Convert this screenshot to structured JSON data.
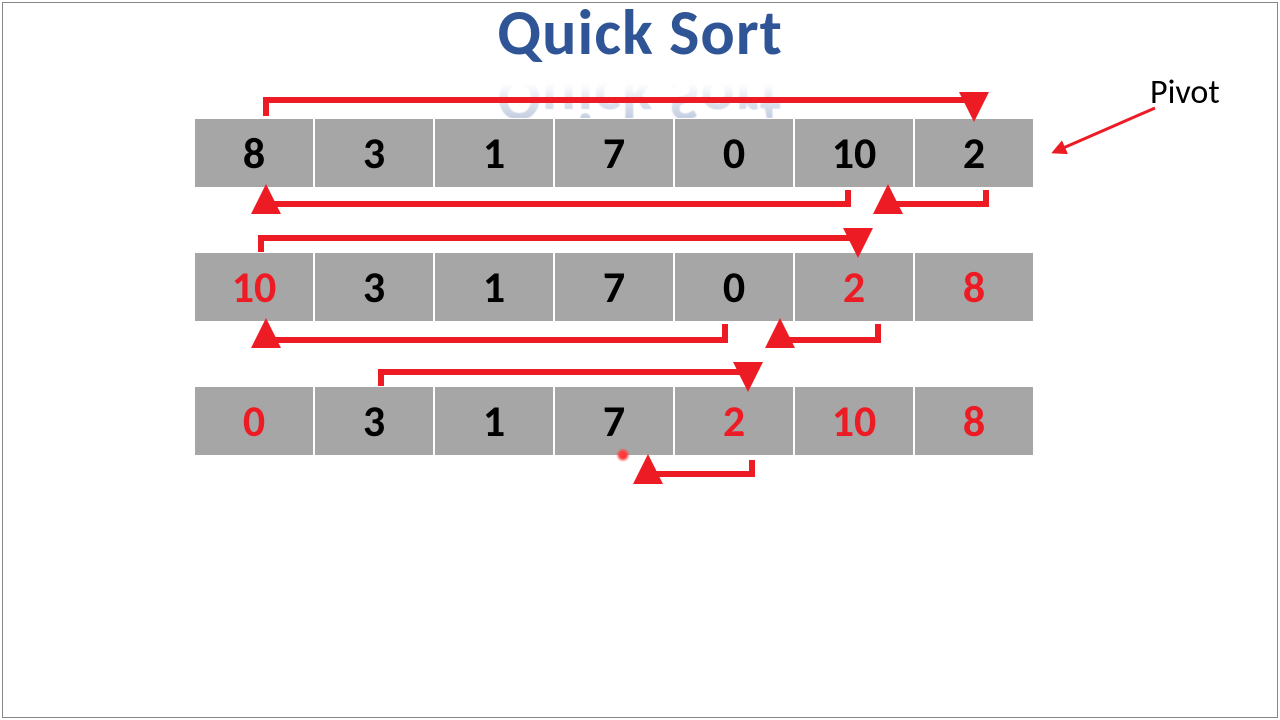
{
  "title": "Quick Sort",
  "pivot_label": "Pivot",
  "rows": [
    {
      "cells": [
        {
          "v": "8",
          "hl": false
        },
        {
          "v": "3",
          "hl": false
        },
        {
          "v": "1",
          "hl": false
        },
        {
          "v": "7",
          "hl": false
        },
        {
          "v": "0",
          "hl": false
        },
        {
          "v": "10",
          "hl": false
        },
        {
          "v": "2",
          "hl": false
        }
      ]
    },
    {
      "cells": [
        {
          "v": "10",
          "hl": true
        },
        {
          "v": "3",
          "hl": false
        },
        {
          "v": "1",
          "hl": false
        },
        {
          "v": "7",
          "hl": false
        },
        {
          "v": "0",
          "hl": false
        },
        {
          "v": "2",
          "hl": true
        },
        {
          "v": "8",
          "hl": true
        }
      ]
    },
    {
      "cells": [
        {
          "v": "0",
          "hl": true
        },
        {
          "v": "3",
          "hl": false
        },
        {
          "v": "1",
          "hl": false
        },
        {
          "v": "7",
          "hl": false
        },
        {
          "v": "2",
          "hl": true
        },
        {
          "v": "10",
          "hl": true
        },
        {
          "v": "8",
          "hl": true
        }
      ]
    }
  ],
  "colors": {
    "accent": "#ed1c24",
    "title": "#2f5597",
    "cell_bg": "#a6a6a6"
  }
}
